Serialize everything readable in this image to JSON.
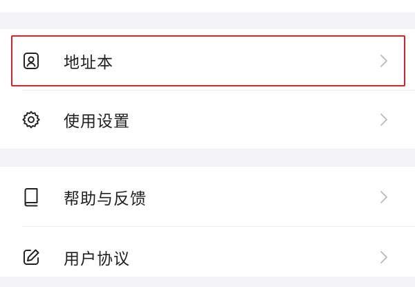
{
  "accent_color": "#d9232a",
  "groups": [
    {
      "items": [
        {
          "label": "地址本",
          "icon": "address-book-icon",
          "highlighted": true
        },
        {
          "label": "使用设置",
          "icon": "gear-icon",
          "highlighted": false
        }
      ]
    },
    {
      "items": [
        {
          "label": "帮助与反馈",
          "icon": "book-icon",
          "highlighted": false
        },
        {
          "label": "用户协议",
          "icon": "edit-icon",
          "highlighted": false
        }
      ]
    }
  ]
}
